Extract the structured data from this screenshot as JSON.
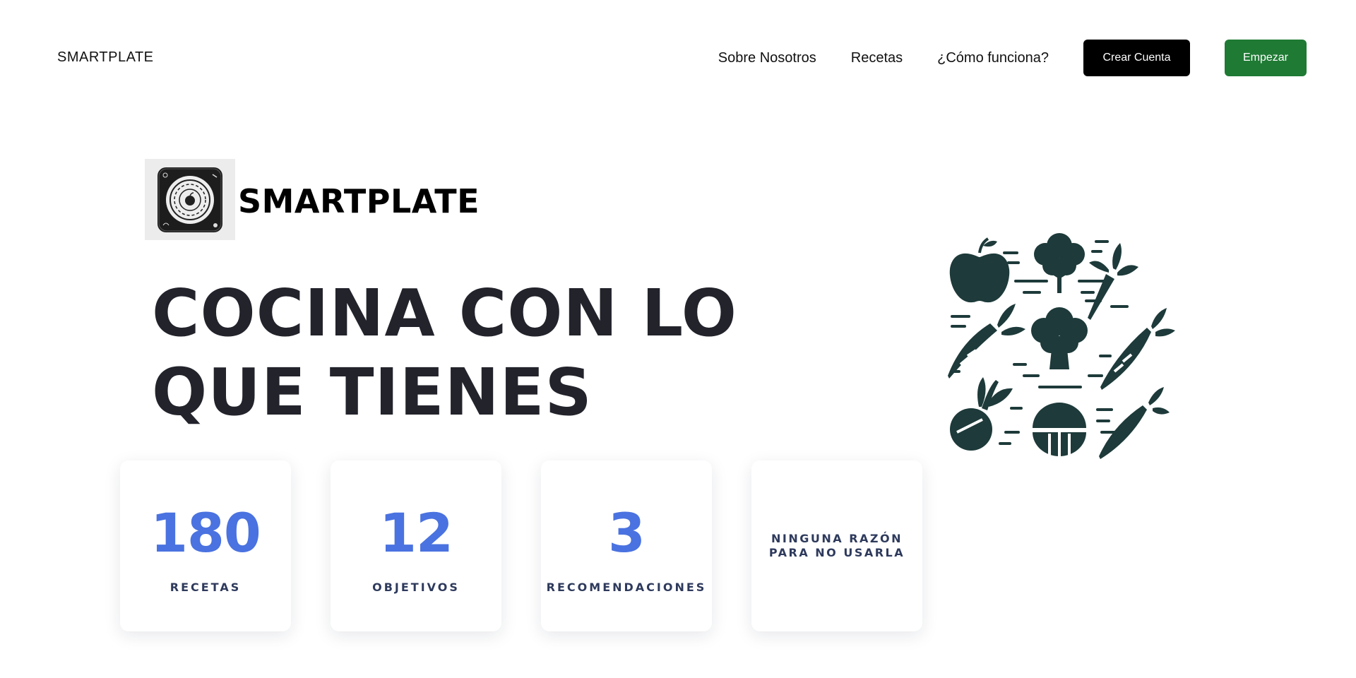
{
  "header": {
    "brand": "SMARTPLATE",
    "nav": [
      "Sobre Nosotros",
      "Recetas",
      "¿Cómo funciona?"
    ],
    "create_account": "Crear Cuenta",
    "start": "Empezar"
  },
  "hero": {
    "logo_icon": "plate-logo-icon",
    "brand": "SMARTPLATE",
    "headline_line1": "COCINA CON LO",
    "headline_line2": "QUE TIENES",
    "illustration_icon": "vegetables-illustration"
  },
  "stats": [
    {
      "number": "180",
      "label": "RECETAS"
    },
    {
      "number": "12",
      "label": "OBJETIVOS"
    },
    {
      "number": "3",
      "label": "RECOMENDACIONES"
    },
    {
      "text_line1": "NINGUNA RAZÓN",
      "text_line2": "PARA NO USARLA"
    }
  ],
  "colors": {
    "accent_blue": "#4a72e0",
    "green_button": "#1f7a34",
    "dark_button": "#000000",
    "headline": "#22232b",
    "illustration": "#1e3a3a"
  }
}
